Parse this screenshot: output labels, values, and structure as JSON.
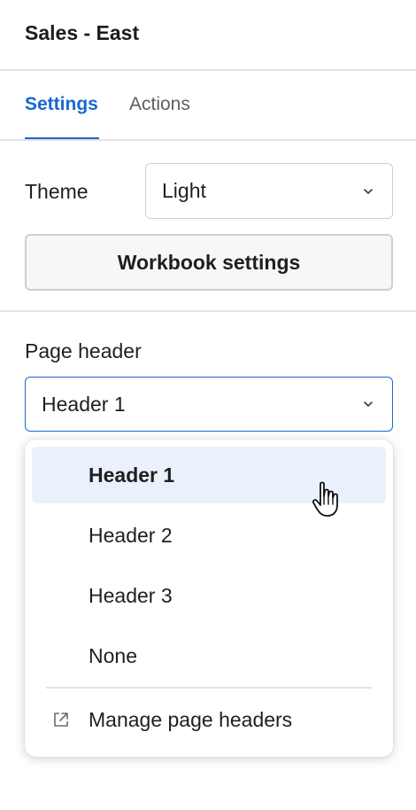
{
  "header": {
    "title": "Sales - East"
  },
  "tabs": [
    {
      "label": "Settings",
      "active": true
    },
    {
      "label": "Actions",
      "active": false
    }
  ],
  "theme": {
    "label": "Theme",
    "value": "Light"
  },
  "workbook_button": {
    "label": "Workbook settings"
  },
  "page_header": {
    "label": "Page header",
    "value": "Header 1",
    "options": [
      {
        "label": "Header 1",
        "selected": true
      },
      {
        "label": "Header 2",
        "selected": false
      },
      {
        "label": "Header 3",
        "selected": false
      },
      {
        "label": "None",
        "selected": false
      }
    ],
    "manage_label": "Manage page headers"
  },
  "colors": {
    "accent": "#1967d2",
    "selected_bg": "#eaf1fc"
  },
  "icons": {
    "dropdown": "chevron-down-icon",
    "external": "external-link-icon",
    "cursor": "hand-pointer-icon"
  }
}
